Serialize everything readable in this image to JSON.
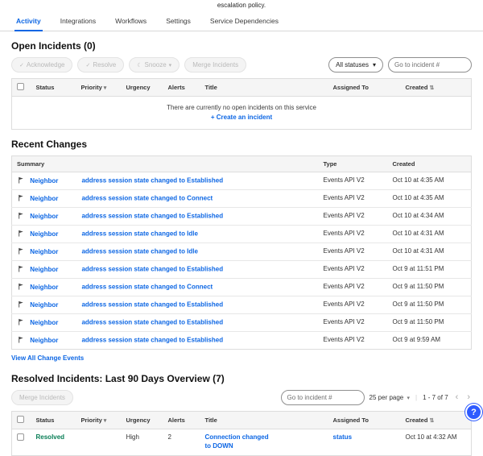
{
  "header": {
    "description_tail": "escalation policy."
  },
  "tabs": [
    {
      "label": "Activity"
    },
    {
      "label": "Integrations"
    },
    {
      "label": "Workflows"
    },
    {
      "label": "Settings"
    },
    {
      "label": "Service Dependencies"
    }
  ],
  "icons": {
    "chevron_down": "▾",
    "sort": "⇅",
    "prev": "‹",
    "next": "›",
    "help": "?",
    "check": "✓",
    "snooze": "☾",
    "divider": "|"
  },
  "open_incidents": {
    "title": "Open Incidents (0)",
    "buttons": {
      "acknowledge": "Acknowledge",
      "resolve": "Resolve",
      "snooze": "Snooze",
      "merge": "Merge Incidents"
    },
    "status_filter": "All statuses",
    "goto_placeholder": "Go to incident #",
    "columns": [
      "Status",
      "Priority",
      "Urgency",
      "Alerts",
      "Title",
      "Assigned To",
      "Created"
    ],
    "empty_text": "There are currently no open incidents on this service",
    "create_link": "+ Create an incident"
  },
  "recent_changes": {
    "title": "Recent Changes",
    "columns": [
      "Summary",
      "Type",
      "Created"
    ],
    "view_all": "View All Change Events",
    "rows": [
      {
        "actor": "Neighbor",
        "summary": "address session state changed to Established",
        "type": "Events API V2",
        "created": "Oct 10 at 4:35 AM"
      },
      {
        "actor": "Neighbor",
        "summary": "address session state changed to Connect",
        "type": "Events API V2",
        "created": "Oct 10 at 4:35 AM"
      },
      {
        "actor": "Neighbor",
        "summary": "address session state changed to Established",
        "type": "Events API V2",
        "created": "Oct 10 at 4:34 AM"
      },
      {
        "actor": "Neighbor",
        "summary": "address session state changed to Idle",
        "type": "Events API V2",
        "created": "Oct 10 at 4:31 AM"
      },
      {
        "actor": "Neighbor",
        "summary": "address session state changed to Idle",
        "type": "Events API V2",
        "created": "Oct 10 at 4:31 AM"
      },
      {
        "actor": "Neighbor",
        "summary": "address session state changed to Established",
        "type": "Events API V2",
        "created": "Oct 9 at 11:51 PM"
      },
      {
        "actor": "Neighbor",
        "summary": "address session state changed to Connect",
        "type": "Events API V2",
        "created": "Oct 9 at 11:50 PM"
      },
      {
        "actor": "Neighbor",
        "summary": "address session state changed to Established",
        "type": "Events API V2",
        "created": "Oct 9 at 11:50 PM"
      },
      {
        "actor": "Neighbor",
        "summary": "address session state changed to Established",
        "type": "Events API V2",
        "created": "Oct 9 at 11:50 PM"
      },
      {
        "actor": "Neighbor",
        "summary": "address session state changed to Established",
        "type": "Events API V2",
        "created": "Oct 9 at 9:59 AM"
      }
    ]
  },
  "resolved_incidents": {
    "title": "Resolved Incidents: Last 90 Days Overview (7)",
    "merge_button": "Merge Incidents",
    "goto_placeholder": "Go to incident #",
    "per_page": "25 per page",
    "range": "1 - 7 of 7",
    "columns": [
      "Status",
      "Priority",
      "Urgency",
      "Alerts",
      "Title",
      "Assigned To",
      "Created"
    ],
    "rows": [
      {
        "status": "Resolved",
        "priority": "",
        "urgency": "High",
        "alerts": "2",
        "title": "Connection changed to DOWN",
        "assigned": "status",
        "created": "Oct 10 at 4:32 AM"
      }
    ]
  },
  "help": {
    "label": "?"
  }
}
